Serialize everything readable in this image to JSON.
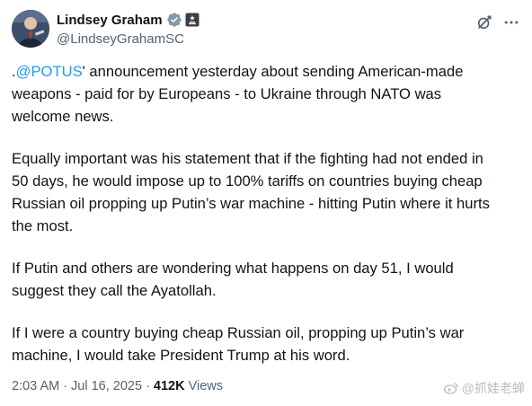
{
  "author": {
    "display_name": "Lindsey Graham",
    "handle": "@LindseyGrahamSC",
    "verified_icon": "verified-badge-icon",
    "affiliation_icon": "government-label-icon"
  },
  "actions": {
    "grok_icon": "grok-icon",
    "more_icon": "more-options-icon"
  },
  "tweet": {
    "p1_prefix": ".",
    "p1_mention": "@POTUS",
    "p1_rest": "' announcement yesterday about sending American-made\nweapons  - paid for by Europeans - to Ukraine through NATO was\nwelcome news.",
    "p2": "Equally important was his statement that if the fighting had not ended in\n50 days, he would impose up to 100% tariffs on countries buying cheap\nRussian oil propping up Putin’s war machine - hitting Putin where it hurts\nthe most.",
    "p3": "If Putin and others are wondering what happens on day 51, I would\nsuggest they call the Ayatollah.",
    "p4": "If I were a country buying cheap Russian oil, propping up Putin’s war\nmachine, I would take President Trump at his word."
  },
  "meta": {
    "time": "2:03 AM",
    "separator": "·",
    "date": "Jul 16, 2025",
    "views_count": "412K",
    "views_label": "Views"
  },
  "watermark": {
    "text": "@抓娃老蝉"
  },
  "colors": {
    "link": "#1d9bf0",
    "secondary_text": "#536471",
    "primary_text": "#0f1419",
    "verified_grey": "#829aab"
  }
}
